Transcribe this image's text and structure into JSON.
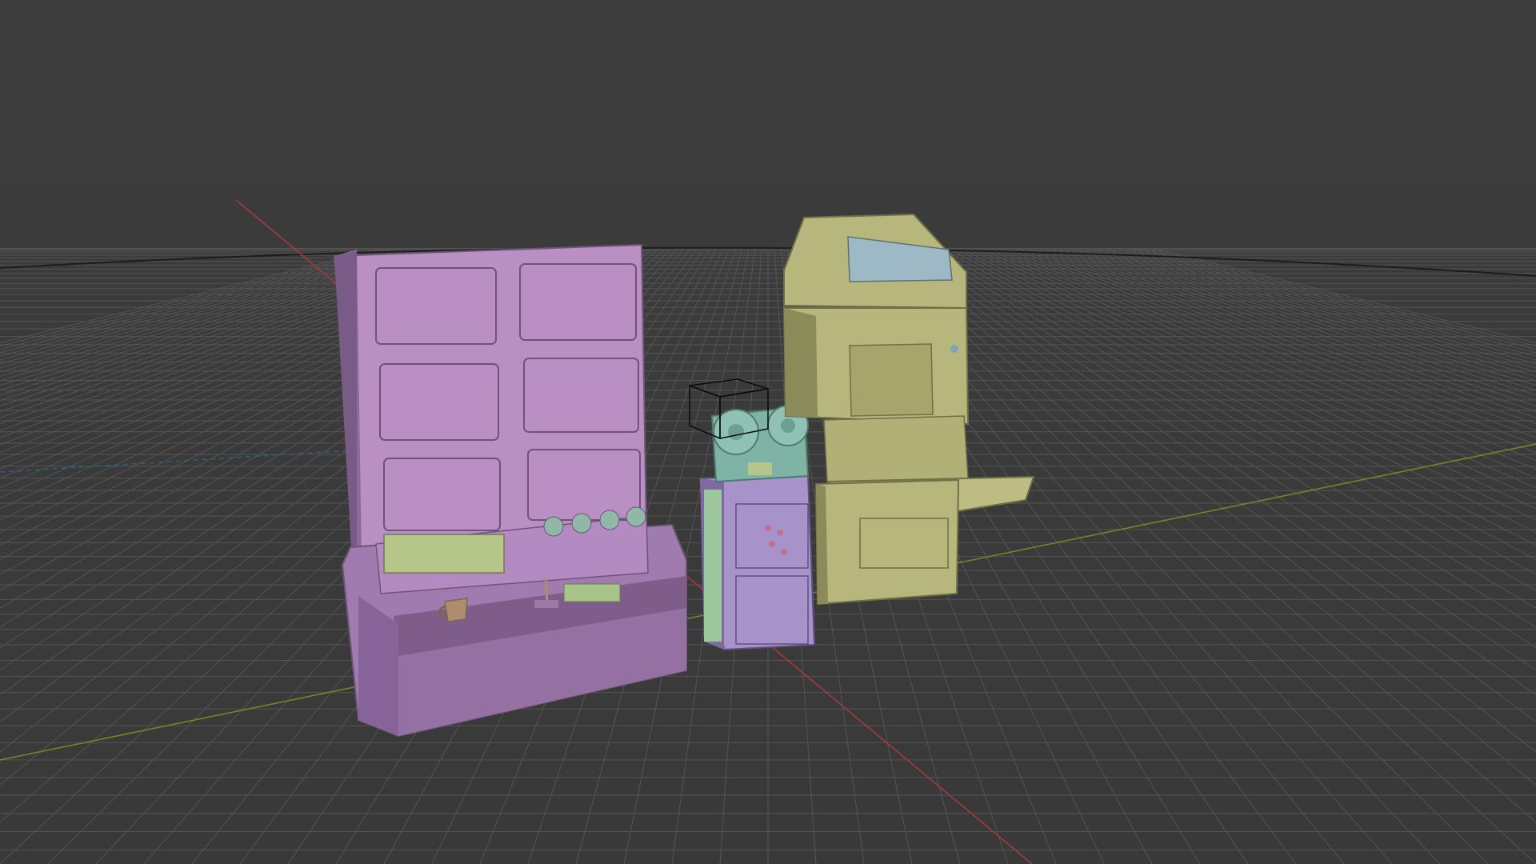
{
  "viewport": {
    "type": "3d-viewport",
    "shading": "solid",
    "colors": {
      "background_top": "#3c3c3c",
      "background_bottom": "#3a3a3a",
      "grid_line": "#545454",
      "horizon": "#1e1e1e",
      "x_axis": "#a8383f",
      "y_axis": "#6a8a2c",
      "z_axis_dashed": "#2f5f78"
    }
  },
  "objects": [
    {
      "name": "mainframe-console",
      "color": "#b98fc4",
      "shade": "#8d6a99"
    },
    {
      "name": "tape-reel-unit",
      "color": "#7fb3a6",
      "shade": "#5d8f84"
    },
    {
      "name": "server-rack",
      "color": "#a792c9",
      "shade": "#7c6aa0"
    },
    {
      "name": "terminal-cabinet",
      "color": "#b7b77d",
      "shade": "#8b8b5a"
    },
    {
      "name": "coffee-mug",
      "color": "#b08c6e",
      "shade": "#8a6a52"
    }
  ],
  "selection": {
    "outline": "empty-cube",
    "color": "#000000"
  }
}
